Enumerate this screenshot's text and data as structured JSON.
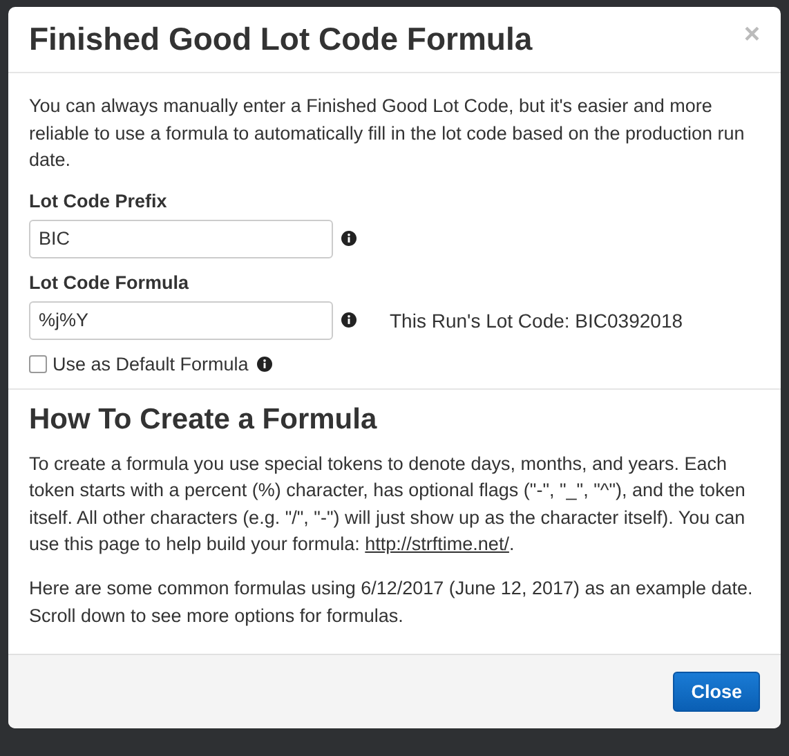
{
  "modal": {
    "title": "Finished Good Lot Code Formula",
    "close_icon": "×"
  },
  "intro": "You can always manually enter a Finished Good Lot Code, but it's easier and more reliable to use a formula to automatically fill in the lot code based on the production run date.",
  "fields": [
    {
      "label": "Lot Code Prefix",
      "value": "BIC"
    },
    {
      "label": "Lot Code Formula",
      "value": "%j%Y",
      "note": "This Run's Lot Code: BIC0392018"
    }
  ],
  "default_checkbox": {
    "label": "Use as Default Formula",
    "checked": false
  },
  "section": {
    "heading": "How To Create a Formula",
    "paragraph": {
      "text": "To create a formula you use special tokens to denote days, months, and years. Each token starts with a percent (%) character, has optional flags (\"-\", \"_\", \"^\"), and the token itself. All other characters (e.g. \"/\", \"-\") will just show up as the character itself). You can use this page to help build your formula:",
      "link": "http://strftime.net/",
      "after": "."
    },
    "paragraph_2": "Here are some common formulas using 6/12/2017 (June 12, 2017) as an example date. Scroll down to see more options for formulas."
  },
  "footer": {
    "button": "Close"
  }
}
